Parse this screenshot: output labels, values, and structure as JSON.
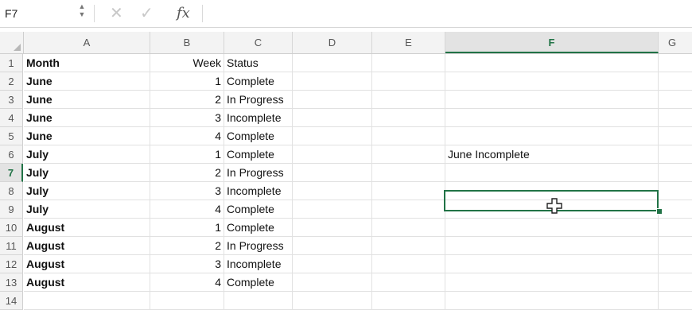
{
  "formula_bar": {
    "name_box": "F7",
    "cancel_icon": "✕",
    "enter_icon": "✓",
    "fx_label": "fx",
    "formula": ""
  },
  "columns": [
    "A",
    "B",
    "C",
    "D",
    "E",
    "F",
    "G"
  ],
  "selected_cell": {
    "column": "F",
    "row": "7"
  },
  "accent_color": "#217346",
  "rows": [
    {
      "num": "1",
      "a": "Month",
      "b": "Week",
      "c": "Status",
      "f": ""
    },
    {
      "num": "2",
      "a": "June",
      "b": "1",
      "c": "Complete",
      "f": ""
    },
    {
      "num": "3",
      "a": "June",
      "b": "2",
      "c": "In Progress",
      "f": ""
    },
    {
      "num": "4",
      "a": "June",
      "b": "3",
      "c": "Incomplete",
      "f": ""
    },
    {
      "num": "5",
      "a": "June",
      "b": "4",
      "c": "Complete",
      "f": ""
    },
    {
      "num": "6",
      "a": "July",
      "b": "1",
      "c": "Complete",
      "f": "June Incomplete"
    },
    {
      "num": "7",
      "a": "July",
      "b": "2",
      "c": "In Progress",
      "f": ""
    },
    {
      "num": "8",
      "a": "July",
      "b": "3",
      "c": "Incomplete",
      "f": ""
    },
    {
      "num": "9",
      "a": "July",
      "b": "4",
      "c": "Complete",
      "f": ""
    },
    {
      "num": "10",
      "a": "August",
      "b": "1",
      "c": "Complete",
      "f": ""
    },
    {
      "num": "11",
      "a": "August",
      "b": "2",
      "c": "In Progress",
      "f": ""
    },
    {
      "num": "12",
      "a": "August",
      "b": "3",
      "c": "Incomplete",
      "f": ""
    },
    {
      "num": "13",
      "a": "August",
      "b": "4",
      "c": "Complete",
      "f": ""
    },
    {
      "num": "14",
      "a": "",
      "b": "",
      "c": "",
      "f": ""
    }
  ]
}
